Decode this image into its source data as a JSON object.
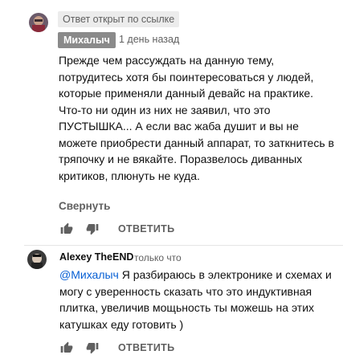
{
  "comment1": {
    "label": "Ответ открыт по ссылке",
    "author": "Михалыч",
    "time": "1 день назад",
    "text": "Прежде чем рассуждать на данную тему, потрудитесь хотя бы поинтересоваться у людей, которые применяли данный девайс на практике. Что-то ни один из них не заявил, что это ПУСТЫШКА... А если вас жаба душит и вы не можете приобрести данный аппарат, то заткнитесь в тряпочку и не вякайте. Поразвелось диванных критиков, плюнуть не куда.",
    "collapse_label": "Свернуть",
    "reply_label": "ОТВЕТИТЬ"
  },
  "comment2": {
    "author": "Alexey TheEND",
    "time": "только что",
    "mention": "@Михалыч",
    "text": " Я разбираюсь в электронике и схемах и могу с уверенность сказать что это индуктивная плитка, увеличив мощьность ты можешь на этих катушках еду готовить )",
    "reply_label": "ОТВЕТИТЬ"
  },
  "icons": {
    "like": "thumbs-up-icon",
    "dislike": "thumbs-down-icon"
  },
  "colors": {
    "link": "#065fd4",
    "secondary_text": "#606060",
    "author_badge": "#8a8a8a"
  }
}
